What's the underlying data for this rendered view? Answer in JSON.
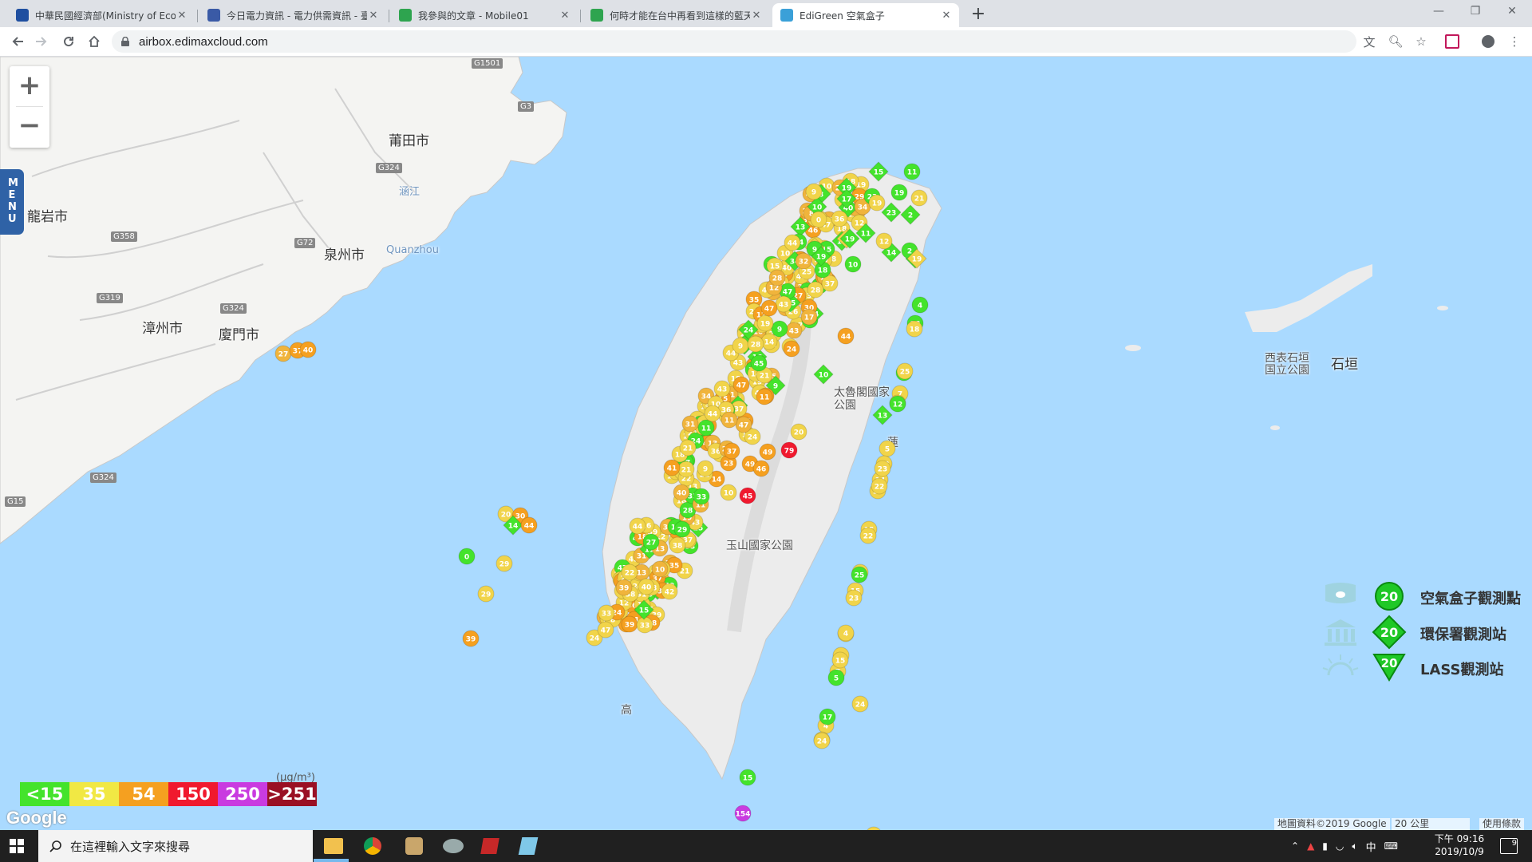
{
  "browser": {
    "tabs": [
      {
        "title": "中華民國經濟部(Ministry of Econ",
        "icon": "moea-icon",
        "color": "#1f4fa0",
        "active": false
      },
      {
        "title": "今日電力資訊 - 電力供需資訊 - 臺",
        "icon": "taipower-icon",
        "color": "#3a5aa6",
        "active": false
      },
      {
        "title": "我參與的文章 - Mobile01",
        "icon": "mobile01-icon",
        "color": "#2ea44f",
        "active": false
      },
      {
        "title": "何時才能在台中再看到這樣的藍天",
        "icon": "mobile01-icon",
        "color": "#2ea44f",
        "active": false
      },
      {
        "title": "EdiGreen 空氣盒子",
        "icon": "edigreen-icon",
        "color": "#3aa0d8",
        "active": true
      }
    ],
    "new_tab": "+",
    "url": "airbox.edimaxcloud.com"
  },
  "map": {
    "zoom_in": "+",
    "zoom_out": "−",
    "menu_label": "MENU",
    "cities": [
      {
        "name": "莆田市",
        "style": "big"
      },
      {
        "name": "龍岩市",
        "style": "big"
      },
      {
        "name": "泉州市",
        "style": "big"
      },
      {
        "name": "Quanzhou",
        "style": "blue"
      },
      {
        "name": "漳州市",
        "style": "big"
      },
      {
        "name": "廈門市",
        "style": "big"
      },
      {
        "name": "石垣",
        "style": "big"
      },
      {
        "name": "西表石垣国立公園",
        "style": "small"
      },
      {
        "name": "太魯閣國家公園",
        "style": "small"
      },
      {
        "name": "玉山國家公園",
        "style": "small"
      },
      {
        "name": "蓮",
        "style": "small"
      },
      {
        "name": "高",
        "style": "small"
      },
      {
        "name": "涵江",
        "style": "blue"
      }
    ],
    "highways": [
      "G1501",
      "G3",
      "G324",
      "G358",
      "G72",
      "G319",
      "G324",
      "G324",
      "G15"
    ],
    "unit_label": "(μg/m³)",
    "color_scale": [
      {
        "label": "<15",
        "color": "#44e32c"
      },
      {
        "label": "35",
        "color": "#f1e844"
      },
      {
        "label": "54",
        "color": "#f5a020"
      },
      {
        "label": "150",
        "color": "#f0192e"
      },
      {
        "label": "250",
        "color": "#c93be0"
      },
      {
        "label": ">251",
        "color": "#9a1024"
      }
    ],
    "legend": [
      {
        "label": "空氣盒子觀測點",
        "value": "20",
        "marker": "circle",
        "icon": "cloud-box-icon"
      },
      {
        "label": "環保署觀測站",
        "value": "20",
        "marker": "diamond",
        "icon": "government-building-icon"
      },
      {
        "label": "LASS觀測站",
        "value": "20",
        "marker": "triangle",
        "icon": "sun-rays-icon"
      }
    ],
    "google_logo": "Google",
    "attribution": "地圖資料©2019 Google",
    "scale_label": "20 公里",
    "terms": "使用條款",
    "offshore_markers": [
      {
        "v": "27",
        "c": "#f0b43c"
      },
      {
        "v": "37",
        "c": "#f5a020"
      },
      {
        "v": "40",
        "c": "#f5a020"
      },
      {
        "v": "20",
        "c": "#f1d44a"
      },
      {
        "v": "30",
        "c": "#f5a020"
      },
      {
        "v": "14",
        "c": "#44e32c",
        "shape": "diamond"
      },
      {
        "v": "44",
        "c": "#f5a020"
      },
      {
        "v": "0",
        "c": "#44e32c"
      },
      {
        "v": "29",
        "c": "#f1d44a"
      },
      {
        "v": "29",
        "c": "#f1d44a"
      },
      {
        "v": "39",
        "c": "#f5a020"
      },
      {
        "v": "24",
        "c": "#f1d44a"
      },
      {
        "v": "21",
        "c": "#f1d44a"
      },
      {
        "v": "154",
        "c": "#c93be0"
      },
      {
        "v": "15",
        "c": "#44e32c"
      },
      {
        "v": "20",
        "c": "#f1d44a"
      },
      {
        "v": "79",
        "c": "#f0192e"
      },
      {
        "v": "49",
        "c": "#f5a020"
      },
      {
        "v": "49",
        "c": "#f5a020"
      },
      {
        "v": "46",
        "c": "#f5a020"
      },
      {
        "v": "45",
        "c": "#f0192e"
      },
      {
        "v": "37",
        "c": "#f5a020"
      },
      {
        "v": "44",
        "c": "#f5a020"
      },
      {
        "v": "10",
        "c": "#44e32c",
        "shape": "diamond"
      },
      {
        "v": "13",
        "c": "#44e32c",
        "shape": "diamond"
      },
      {
        "v": "4",
        "c": "#44e32c"
      },
      {
        "v": "1",
        "c": "#44e32c"
      }
    ]
  },
  "taskbar": {
    "search_placeholder": "在這裡輸入文字來搜尋",
    "time": "下午 09:16",
    "date": "2019/10/9",
    "ime": "中",
    "notifications": "9"
  }
}
